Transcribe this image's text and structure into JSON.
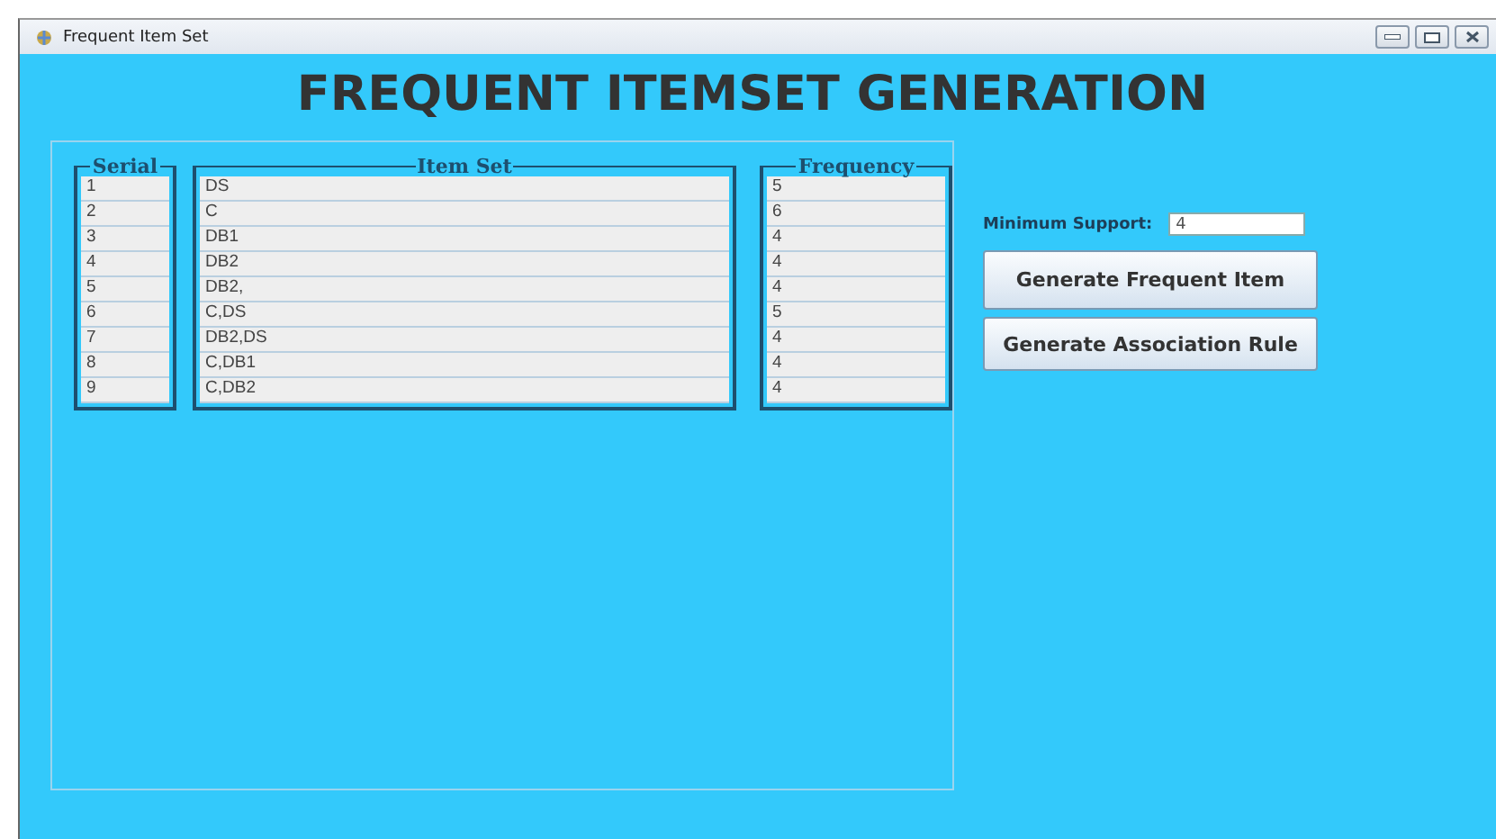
{
  "window": {
    "title": "Frequent Item Set"
  },
  "heading": "FREQUENT ITEMSET GENERATION",
  "lists": [
    {
      "title": "Serial",
      "items": [
        "1",
        "2",
        "3",
        "4",
        "5",
        "6",
        "7",
        "8",
        "9"
      ]
    },
    {
      "title": "Item Set",
      "items": [
        "DS",
        "C",
        "DB1",
        "DB2",
        "DB2,",
        "C,DS",
        "DB2,DS",
        "C,DB1",
        "C,DB2"
      ]
    },
    {
      "title": "Frequency",
      "items": [
        "5",
        "6",
        "4",
        "4",
        "4",
        "5",
        "4",
        "4",
        "4"
      ]
    }
  ],
  "minimum_support": {
    "label": "Minimum Support:",
    "value": "4"
  },
  "buttons": [
    "Generate Frequent Item",
    "Generate Association Rule"
  ]
}
